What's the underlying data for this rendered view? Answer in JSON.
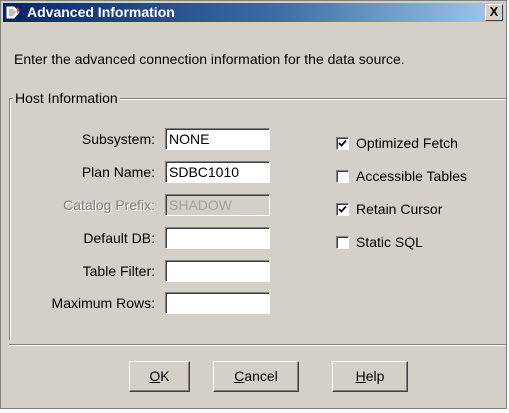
{
  "window": {
    "title": "Advanced Information",
    "close_label": "X",
    "icon": "datasource-app-icon"
  },
  "intro_text": "Enter the advanced connection information for the data source.",
  "host_group": {
    "legend": "Host Information",
    "fields": [
      {
        "label": "Subsystem:",
        "value": "NONE",
        "enabled": true
      },
      {
        "label": "Plan Name:",
        "value": "SDBC1010",
        "enabled": true
      },
      {
        "label": "Catalog Prefix:",
        "value": "SHADOW",
        "enabled": false
      },
      {
        "label": "Default DB:",
        "value": "",
        "enabled": true
      },
      {
        "label": "Table Filter:",
        "value": "",
        "enabled": true
      },
      {
        "label": "Maximum Rows:",
        "value": "",
        "enabled": true
      }
    ],
    "options": [
      {
        "label": "Optimized Fetch",
        "checked": true
      },
      {
        "label": "Accessible Tables",
        "checked": false
      },
      {
        "label": "Retain Cursor",
        "checked": true
      },
      {
        "label": "Static SQL",
        "checked": false
      }
    ]
  },
  "buttons": {
    "ok": {
      "mnemonic": "O",
      "rest": "K"
    },
    "cancel": {
      "mnemonic": "C",
      "rest": "ancel"
    },
    "help": {
      "mnemonic": "H",
      "rest": "elp"
    }
  },
  "colors": {
    "dialog_face": "#d4d0c8",
    "title_gradient_start": "#0a246a",
    "title_gradient_end": "#a6caf0",
    "disabled_text": "#808080"
  }
}
